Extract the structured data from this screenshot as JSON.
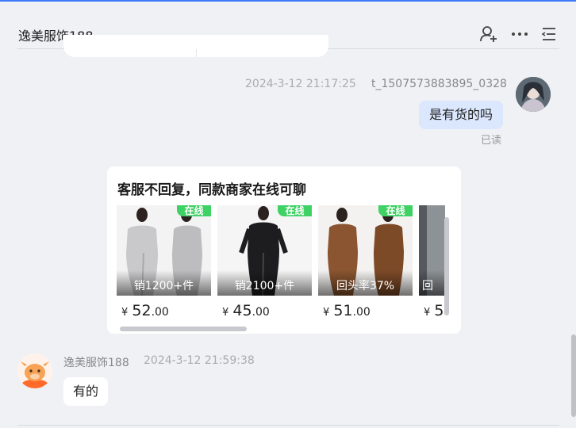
{
  "header": {
    "title": "逸美服饰188",
    "icons": [
      "add-contact-icon",
      "more-icon",
      "menu-list-icon"
    ]
  },
  "outgoing_message": {
    "timestamp": "2024-3-12 21:17:25",
    "sender": "t_1507573883895_0328",
    "text": "是有货的吗",
    "read_status": "已读"
  },
  "recommendation": {
    "title": "客服不回复，同款商家在线可聊",
    "products": [
      {
        "badge": "在线",
        "stat": "销1200+件",
        "currency": "¥",
        "price_int": "52",
        "price_dec": ".00",
        "color": "#c9c9cb"
      },
      {
        "badge": "在线",
        "stat": "销2100+件",
        "currency": "¥",
        "price_int": "45",
        "price_dec": ".00",
        "color": "#1d1d1f"
      },
      {
        "badge": "在线",
        "stat": "回头率37%",
        "currency": "¥",
        "price_int": "51",
        "price_dec": ".00",
        "color": "#8a5530"
      },
      {
        "badge": "",
        "stat": "回",
        "currency": "¥",
        "price_int": "5",
        "price_dec": "",
        "color": "#55595e"
      }
    ]
  },
  "incoming_message": {
    "sender": "逸美服饰188",
    "timestamp": "2024-3-12 21:59:38",
    "text": "有的"
  },
  "colors": {
    "accent": "#3d7bf7",
    "online_badge": "#3ed163",
    "outgoing_bubble": "#dbe7fd",
    "background": "#f0f1f5"
  }
}
